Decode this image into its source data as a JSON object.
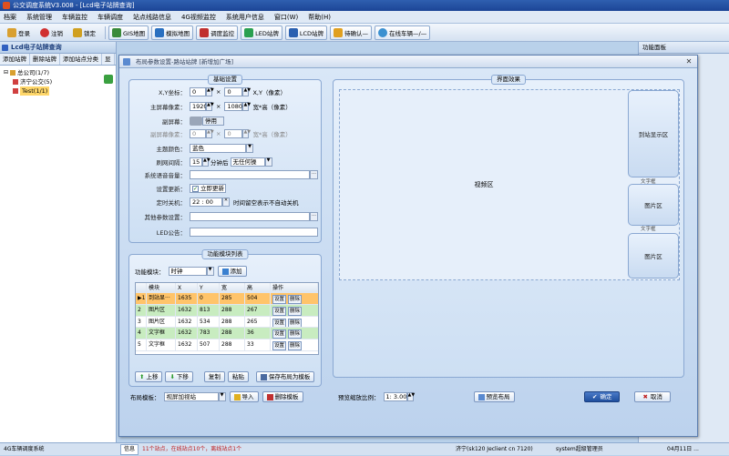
{
  "app": {
    "title": "公交调度系统V3.008 - [Lcd电子站牌查询]"
  },
  "menu": [
    "档案",
    "系统管理",
    "车辆监控",
    "车辆调度",
    "站点线路信息",
    "4G视频监控",
    "系统用户信息",
    "窗口(W)",
    "帮助(H)"
  ],
  "toolbar": [
    "登录",
    "注销",
    "锁定",
    "GIS地图",
    "模拟地图",
    "调度监控",
    "LED站牌",
    "LCD站牌",
    "待确认—",
    "在线车辆—/—"
  ],
  "left_panel": {
    "title": "Lcd电子站牌查询",
    "tabs": [
      "添加站牌",
      "删除站牌",
      "添加站点分类",
      "显"
    ],
    "tree": [
      {
        "label": "总公司(1/7)",
        "level": 0
      },
      {
        "label": "济宁公交(5)",
        "level": 1
      },
      {
        "label": "Test(1/1)",
        "level": 1,
        "selected": true
      }
    ]
  },
  "right_panel": {
    "title": "功能面板"
  },
  "dialog": {
    "title": "布局参数设置-路站站牌 [新增加广场]",
    "basic": {
      "title": "基础设置",
      "xy_label": "X,Y坐标：",
      "x": "0",
      "y": "0",
      "xy_unit": "X,Y（像素）",
      "screen_label": "主屏幕像素：",
      "w": "1920",
      "h": "1080",
      "screen_unit": "宽*高（像素）",
      "subscreen_label": "副屏幕：",
      "subscreen_toggle": "停用",
      "subpix_label": "副屏幕像素：",
      "sw": "0",
      "sh": "0",
      "subpix_unit": "宽*高（像素）",
      "theme_label": "主题颜色：",
      "theme_value": "蓝色",
      "refresh_label": "刷网间隔：",
      "refresh_value": "15",
      "refresh_unit": "分钟后",
      "refresh_option": "无任何操",
      "tts_label": "系统语音音量：",
      "tts_value": "",
      "effect_label": "设置更新：",
      "effect_check": "立即更新",
      "shutdown_label": "定时关机：",
      "shutdown_value": "22 : 00",
      "shutdown_note": "时间留空表示不自动关机",
      "other_label": "其他参数设置：",
      "other_value": "",
      "led_label": "LED公告：",
      "led_value": ""
    },
    "modules": {
      "title": "功能模块列表",
      "select_label": "功能模块：",
      "select_value": "时钟",
      "add_label": "添加",
      "columns": [
        "模块",
        "X",
        "Y",
        "宽",
        "高",
        "操作"
      ],
      "rows": [
        {
          "marker": "▶1",
          "name": "到站显···",
          "x": "1635",
          "y": "0",
          "w": "285",
          "h": "504"
        },
        {
          "marker": "2",
          "name": "图片区",
          "x": "1632",
          "y": "813",
          "w": "288",
          "h": "267"
        },
        {
          "marker": "3",
          "name": "图片区",
          "x": "1632",
          "y": "534",
          "w": "288",
          "h": "265"
        },
        {
          "marker": "4",
          "name": "文字框",
          "x": "1632",
          "y": "783",
          "w": "288",
          "h": "36"
        },
        {
          "marker": "5",
          "name": "文字框",
          "x": "1632",
          "y": "507",
          "w": "288",
          "h": "33"
        }
      ],
      "row_btn_set": "设置",
      "row_btn_del": "删除",
      "up_label": "上移",
      "down_label": "下移",
      "copy_label": "复制",
      "paste_label": "粘贴",
      "save_tpl_label": "保存布局为模板"
    },
    "preview": {
      "title": "界面效果",
      "video_label": "视频区",
      "arrive_label": "到站显示区",
      "img1_label": "图片区",
      "img2_label": "图片区",
      "text1_label": "文字框",
      "text2_label": "文字框"
    },
    "footer": {
      "tpl_label": "布局模板：",
      "tpl_value": "视屏加视站",
      "import_label": "导入",
      "del_tpl_label": "删除模板",
      "ratio_label": "预览缩放比例：",
      "ratio_value": "1: 3.00",
      "preview_btn": "预览布局",
      "ok_label": "确定",
      "cancel_label": "取消"
    }
  },
  "status": {
    "left": "4G车辆调度系统",
    "tab": "信息",
    "alert": "11个站点，在线站点10个，离线站点1个",
    "server": "济宁(sk120 Jeclient cn 7120)",
    "user": "system超级管理员",
    "date": "04月11日 ..."
  }
}
